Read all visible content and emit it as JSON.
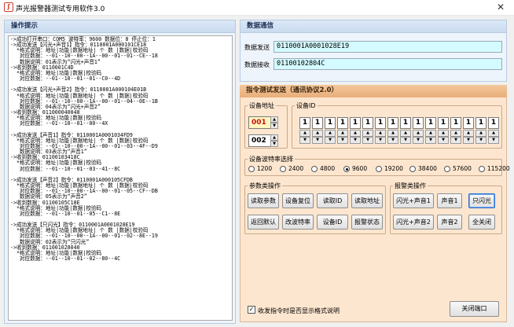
{
  "window": {
    "title": "声光报警器测试专用软件3.0",
    "close_glyph": "✕",
    "icon_glyph": "ʃ"
  },
  "log_panel": {
    "title": "操作提示",
    "lines": [
      "->成功打开串口：COM5 波特率：9600 数据位：8 停止位：1",
      "->成功发送【闪光+声音1】指令：0110001A000101CE18",
      "  *格式说明：地址|功能|数据地址| 个 数 |数据|校验码",
      "   对应数据：--01--10--00--1A--00--01--01--CE--18",
      "   数据说明：01表示为“闪光+声音1”",
      "->收到数据：0110001C4D",
      "  *格式说明：地址|功能|数据|校验码",
      "   对应数据：--01--10--01--01--C0--4D",
      "",
      "->成功发送【闪光+声音2】指令：0110001A000104E01B",
      "  *格式说明：地址|功能|数据地址| 个 数 |数据|校验码",
      "   对应数据：--01--10--00--1A--00--01--04--0E--1B",
      "   数据说明：04表示为“闪光+声音2”",
      "->收到数据：011000040048",
      "  *格式说明：地址|功能|数据|校验码",
      "   对应数据：--01--10--01--00--4X",
      "",
      "->成功发送【声音1】指令：0110001A0001034FD9",
      "  *格式说明：地址|功能|数据地址| 个 数 |数据|校验码",
      "   对应数据：--01--10--00--1A--00--01--03--4F--D9",
      "   数据说明：03表示为“声音1”",
      "->收到数据：01100103418C",
      "  *格式说明：地址|功能|数据|校验码",
      "   对应数据：--01--10--01--03--41--8C",
      "",
      "->成功发送【声音2】指令：0110001A000105CFDB",
      "  *格式说明：地址|功能|数据地址| 个 数 |数据|校验码",
      "   对应数据：--01--10--00--1A--00--01--05--CF--DB",
      "   数据说明：05表示为“声音2”",
      "->收到数据：01100105C18E",
      "  *格式说明：地址|功能|数据|校验码",
      "   对应数据：--01--10--01--05--C1--8E",
      "",
      "->成功发送【只闪光】指令：0110001A0001028E19",
      "  *格式说明：地址|功能|数据地址| 个 数 |数据|校验码",
      "   对应数据：--01--10--00--1A--00--01--02--8E--19",
      "   数据说明：02表示为“只闪光”",
      "->收到数据：011001028040",
      "  *格式说明：地址|功能|数据|校验码",
      "   对应数据：--01--10--01--02--80--4C"
    ]
  },
  "comm_panel": {
    "title": "数据通信",
    "send_label": "数据发送",
    "send_value": "0110001A0001028E19",
    "recv_label": "数据接收",
    "recv_value": "01100102804C"
  },
  "cmd_panel": {
    "title": "指令测试发送（通讯协议2.0）",
    "device_addr": {
      "label": "设备地址",
      "value1": "001",
      "value2": "002",
      "up": "▲",
      "down": "▼"
    },
    "device_id": {
      "label": "设备ID",
      "bits": [
        "1",
        "1",
        "1",
        "1",
        "1",
        "1",
        "1",
        "1",
        "1",
        "1",
        "1",
        "1",
        "1",
        "1",
        "1",
        "1"
      ],
      "up": "▲",
      "down": "▼"
    },
    "baud": {
      "label": "设备波特率选择",
      "options": [
        "1200",
        "2400",
        "4800",
        "9600",
        "19200",
        "38400",
        "57600",
        "115200"
      ],
      "selected": "9600"
    },
    "params": {
      "label": "参数类操作",
      "buttons": [
        "读取参数",
        "设备复位",
        "读取ID",
        "读取地址",
        "返回默认",
        "改波特率",
        "设备ID",
        "报警状态"
      ]
    },
    "alarm": {
      "label": "报警类操作",
      "buttons": [
        "闪光+声音1",
        "声音1",
        "只闪光",
        "闪光+声音2",
        "声音2",
        "全关闭"
      ],
      "active": "只闪光"
    },
    "checkbox": {
      "label": "收发指令时是否显示格式说明",
      "checked": true,
      "mark": "✓"
    },
    "close_port": "关闭端口"
  }
}
